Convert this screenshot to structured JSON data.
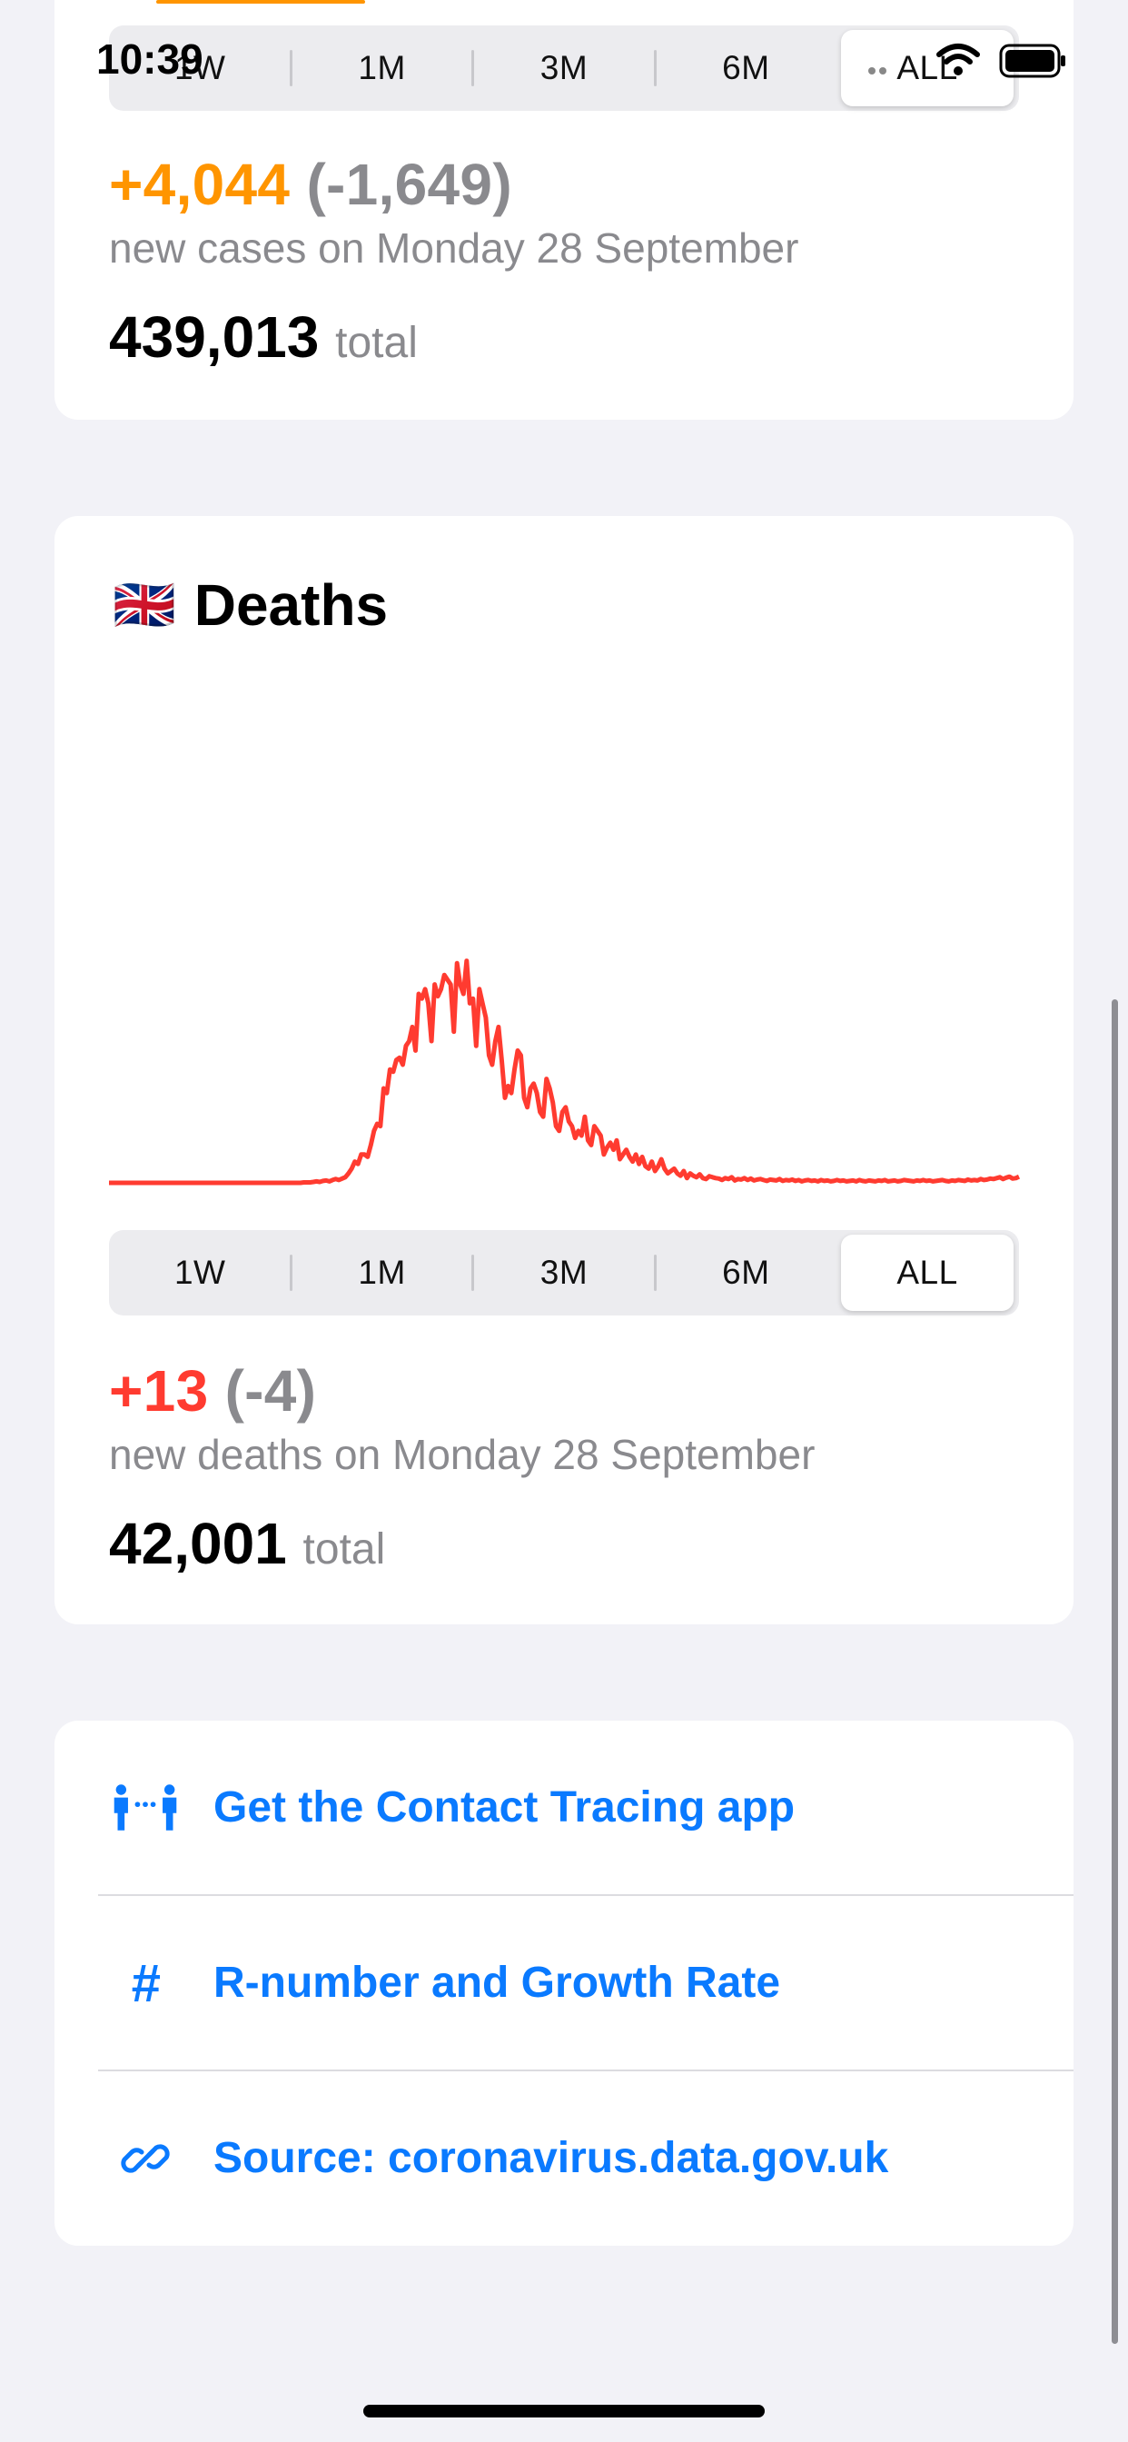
{
  "status_bar": {
    "time": "10:39"
  },
  "cases_card": {
    "range_options": [
      "1W",
      "1M",
      "3M",
      "6M",
      "ALL"
    ],
    "selected_range": "ALL",
    "new_value": "+4,044",
    "change": "(-1,649)",
    "caption": "new cases on Monday 28 September",
    "total_value": "439,013",
    "total_unit": "total",
    "accent_color": "#ff9500"
  },
  "deaths_card": {
    "flag": "🇬🇧",
    "title": "Deaths",
    "range_options": [
      "1W",
      "1M",
      "3M",
      "6M",
      "ALL"
    ],
    "selected_range": "ALL",
    "new_value": "+13",
    "change": "(-4)",
    "caption": "new deaths on Monday 28 September",
    "total_value": "42,001",
    "total_unit": "total",
    "accent_color": "#ff3b30"
  },
  "chart_data": {
    "type": "line",
    "series": [
      {
        "values": [
          0,
          0,
          0,
          0,
          0,
          0,
          0,
          0,
          0,
          0,
          0,
          0,
          0,
          0,
          0,
          0,
          0,
          0,
          0,
          0,
          0,
          0,
          0,
          0,
          0,
          0,
          0,
          0,
          0,
          0,
          0,
          0,
          0,
          0,
          0,
          0,
          0,
          0,
          0,
          0,
          0,
          0,
          0,
          0,
          0,
          0,
          0,
          0,
          0,
          0,
          0,
          0,
          0,
          0,
          0,
          0,
          0,
          0,
          0,
          0,
          0,
          1,
          1,
          1,
          2,
          3,
          2,
          4,
          5,
          3,
          6,
          8,
          6,
          9,
          12,
          20,
          30,
          45,
          40,
          60,
          60,
          55,
          80,
          110,
          125,
          120,
          200,
          190,
          240,
          235,
          260,
          265,
          250,
          290,
          300,
          330,
          280,
          400,
          390,
          410,
          380,
          300,
          420,
          395,
          410,
          440,
          430,
          420,
          320,
          465,
          420,
          400,
          470,
          380,
          390,
          290,
          410,
          380,
          350,
          270,
          250,
          300,
          330,
          260,
          180,
          205,
          190,
          240,
          280,
          270,
          180,
          160,
          200,
          210,
          190,
          150,
          140,
          220,
          200,
          170,
          120,
          110,
          150,
          160,
          130,
          120,
          95,
          110,
          100,
          140,
          90,
          80,
          120,
          110,
          100,
          60,
          75,
          85,
          70,
          90,
          50,
          60,
          70,
          55,
          45,
          60,
          40,
          55,
          35,
          30,
          45,
          25,
          35,
          50,
          30,
          20,
          25,
          30,
          20,
          15,
          25,
          10,
          20,
          15,
          12,
          18,
          10,
          8,
          14,
          12,
          10,
          9,
          6,
          10,
          8,
          12,
          5,
          8,
          7,
          10,
          6,
          9,
          5,
          7,
          8,
          6,
          4,
          7,
          6,
          5,
          8,
          4,
          6,
          5,
          7,
          4,
          6,
          3,
          5,
          6,
          4,
          5,
          3,
          6,
          4,
          5,
          3,
          4,
          6,
          4,
          5,
          3,
          4,
          5,
          3,
          6,
          4,
          3,
          5,
          4,
          3,
          5,
          4,
          6,
          3,
          4,
          5,
          3,
          4,
          6,
          5,
          4,
          3,
          5,
          4,
          6,
          4,
          5,
          3,
          4,
          5,
          6,
          4,
          3,
          5,
          4,
          6,
          5,
          4,
          7,
          5,
          6,
          5,
          8,
          6,
          7,
          9,
          8,
          10,
          12,
          8,
          11,
          13,
          9,
          10,
          13
        ]
      }
    ],
    "ymax": 1100
  },
  "links": [
    {
      "icon": "person-contact-icon",
      "label": "Get the Contact Tracing app"
    },
    {
      "icon": "hash-icon",
      "label": "R-number and Growth Rate"
    },
    {
      "icon": "link-icon",
      "label": "Source: coronavirus.data.gov.uk"
    }
  ]
}
